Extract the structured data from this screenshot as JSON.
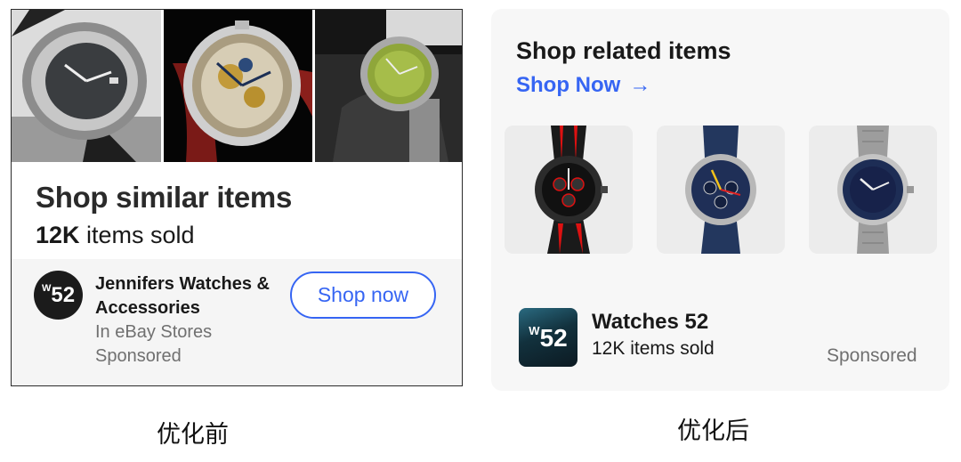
{
  "before": {
    "images": [
      "silver-watch-photo",
      "skeleton-watch-photo",
      "green-dial-watch-photo"
    ],
    "title": "Shop similar items",
    "sold_count": "12K",
    "sold_suffix": " items sold",
    "logo_text": "52",
    "logo_superscript": "W",
    "store_name": "Jennifers Watches & Accessories",
    "store_location": "In eBay Stores",
    "sponsored": "Sponsored",
    "button_label": "Shop now"
  },
  "after": {
    "title": "Shop related items",
    "link_label": "Shop Now",
    "link_arrow": "→",
    "thumbnails": [
      "red-black-chronograph-photo",
      "blue-racing-chronograph-photo",
      "blue-diver-watch-photo"
    ],
    "logo_text": "52",
    "logo_superscript": "W",
    "store_name": "Watches 52",
    "sold_text": "12K items sold",
    "sponsored": "Sponsored"
  },
  "captions": {
    "before": "优化前",
    "after": "优化后"
  },
  "colors": {
    "accent_blue": "#3665f3",
    "muted_text": "#707070",
    "card_gray": "#f7f7f7"
  }
}
